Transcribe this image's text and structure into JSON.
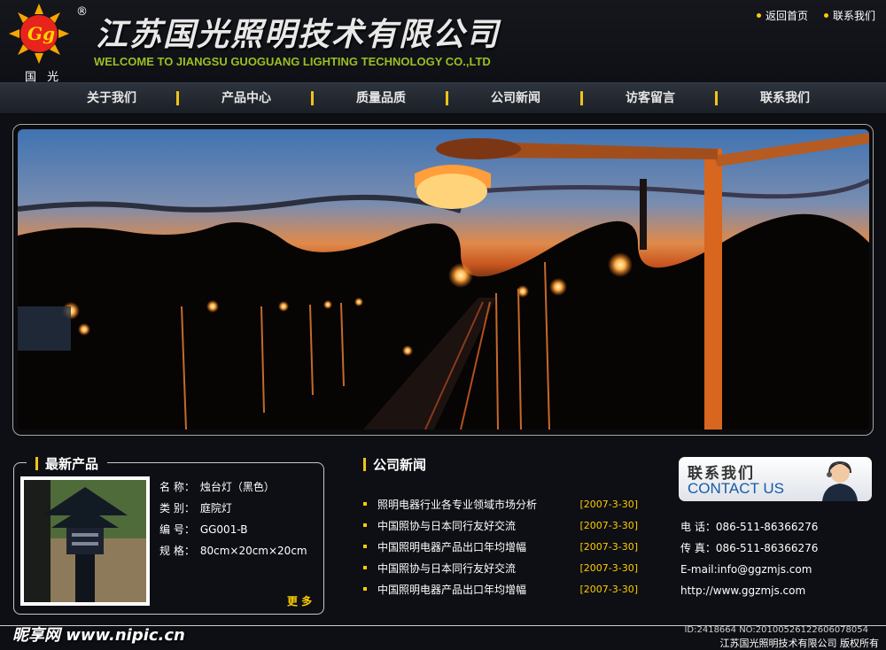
{
  "header": {
    "logo_text": "国 光",
    "registered_mark": "®",
    "company_cn": "江苏国光照明技术有限公司",
    "company_en": "WELCOME TO JIANGSU GUOGUANG LIGHTING TECHNOLOGY CO.,LTD",
    "links": [
      {
        "label": "返回首页",
        "icon": "dot-icon"
      },
      {
        "label": "联系我们",
        "icon": "dot-icon"
      }
    ]
  },
  "nav": {
    "items": [
      {
        "label": "关于我们"
      },
      {
        "label": "产品中心"
      },
      {
        "label": "质量品质"
      },
      {
        "label": "公司新闻"
      },
      {
        "label": "访客留言"
      },
      {
        "label": "联系我们"
      }
    ]
  },
  "products": {
    "title": "最新产品",
    "rows": [
      {
        "label": "名 称：",
        "value": "烛台灯（黑色）"
      },
      {
        "label": "类 别：",
        "value": "庭院灯"
      },
      {
        "label": "编 号：",
        "value": "GG001-B"
      },
      {
        "label": "规 格：",
        "value": "80cm×20cm×20cm"
      }
    ],
    "more": "更 多"
  },
  "news": {
    "title": "公司新闻",
    "items": [
      {
        "text": "照明电器行业各专业领域市场分析",
        "date": "[2007-3-30]"
      },
      {
        "text": "中国照协与日本同行友好交流",
        "date": "[2007-3-30]"
      },
      {
        "text": "中国照明电器产品出口年均增幅",
        "date": "[2007-3-30]"
      },
      {
        "text": "中国照协与日本同行友好交流",
        "date": "[2007-3-30]"
      },
      {
        "text": "中国照明电器产品出口年均增幅",
        "date": "[2007-3-30]"
      }
    ]
  },
  "contact": {
    "banner_cn": "联系我们",
    "banner_en": "CONTACT US",
    "phone": "电  话：086-511-86366276",
    "fax": "传  真：086-511-86366276",
    "email": "E-mail:info@ggzmjs.com",
    "web": "http://www.ggzmjs.com"
  },
  "footer": {
    "watermark": "昵享网 www.nipic.cn",
    "image_id": "ID:2418664 NO:20100526122606078054",
    "copyright": "江苏国光照明技术有限公司  版权所有"
  },
  "colors": {
    "accent_yellow": "#ffcc00",
    "nav_separator": "#f0c419",
    "slogan_green": "#9bbf22",
    "background": "#0d0f14"
  }
}
